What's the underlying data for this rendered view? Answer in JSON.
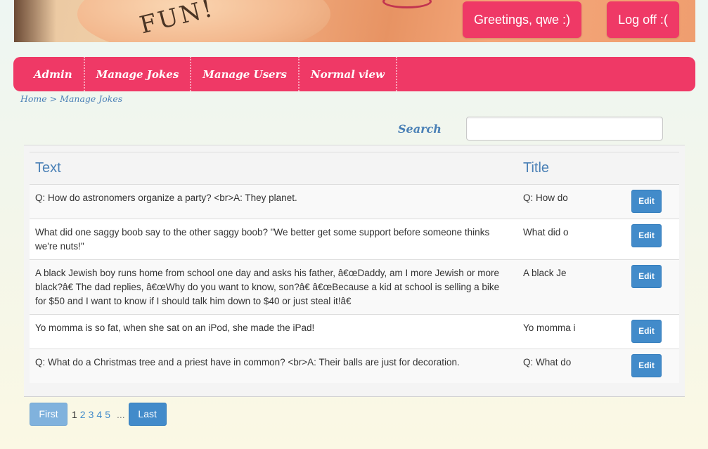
{
  "header": {
    "banner_text": "FUN!",
    "greeting_label": "Greetings, qwe :)",
    "logoff_label": "Log off :("
  },
  "nav": {
    "items": [
      {
        "label": "Admin"
      },
      {
        "label": "Manage Jokes"
      },
      {
        "label": "Manage Users"
      },
      {
        "label": "Normal view"
      }
    ]
  },
  "breadcrumb": {
    "home": "Home",
    "separator": ">",
    "current": "Manage Jokes"
  },
  "search": {
    "label": "Search",
    "value": "",
    "placeholder": ""
  },
  "table": {
    "headers": {
      "text": "Text",
      "title": "Title"
    },
    "rows": [
      {
        "text": "Q: How do astronomers organize a party? <br>A: They planet.",
        "title": "Q: How do",
        "action": "Edit"
      },
      {
        "text": "What did one saggy boob say to the other saggy boob? \"We better get some support before someone thinks we're nuts!\"",
        "title": "What did o",
        "action": "Edit"
      },
      {
        "text": "A black Jewish boy runs home from school one day and asks his father, â€œDaddy, am I more Jewish or more black?â€ The dad replies, â€œWhy do you want to know, son?â€ â€œBecause a kid at school is selling a bike for $50 and I want to know if I should talk him down to $40 or just steal it!â€",
        "title": "A black Je",
        "action": "Edit"
      },
      {
        "text": "Yo momma is so fat, when she sat on an iPod, she made the iPad!",
        "title": "Yo momma i",
        "action": "Edit"
      },
      {
        "text": "Q: What do a Christmas tree and a priest have in common? <br>A: Their balls are just for decoration.",
        "title": "Q: What do",
        "action": "Edit"
      }
    ]
  },
  "pager": {
    "first_label": "First",
    "pages": [
      "1",
      "2",
      "3",
      "4",
      "5"
    ],
    "current_page": "1",
    "ellipsis": "...",
    "last_label": "Last"
  },
  "colors": {
    "accent_pink": "#ef3966",
    "link_blue": "#4a80b6",
    "button_blue": "#428bca",
    "button_blue_disabled": "#80b2dd"
  }
}
